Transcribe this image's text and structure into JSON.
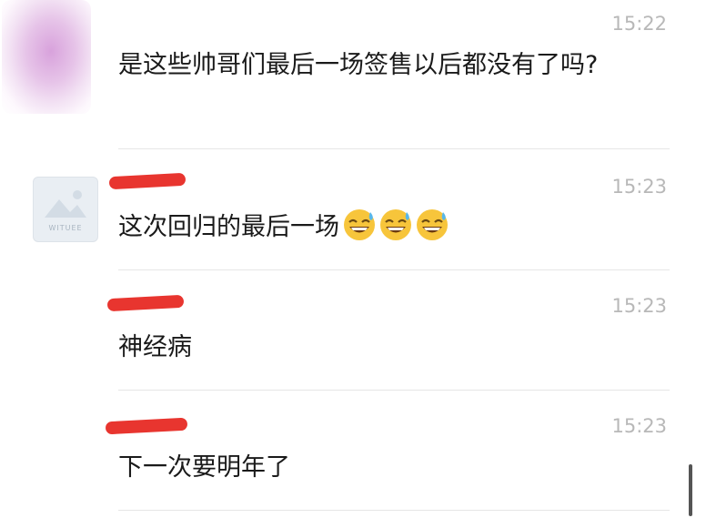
{
  "messages": [
    {
      "time": "15:22",
      "text": "是这些帅哥们最后一场签售以后都没有了吗?",
      "emojis": []
    },
    {
      "time": "15:23",
      "text": "这次回归的最后一场",
      "emojis": [
        "grinning-sweat-emoji",
        "grinning-sweat-emoji",
        "grinning-sweat-emoji"
      ],
      "avatar_label": "WITUEE"
    },
    {
      "time": "15:23",
      "text": "神经病",
      "emojis": []
    },
    {
      "time": "15:23",
      "text": "下一次要明年了",
      "emojis": []
    }
  ],
  "colors": {
    "redaction": "#e8352f",
    "timestamp": "#b8b8b8",
    "text": "#1a1a1a"
  }
}
